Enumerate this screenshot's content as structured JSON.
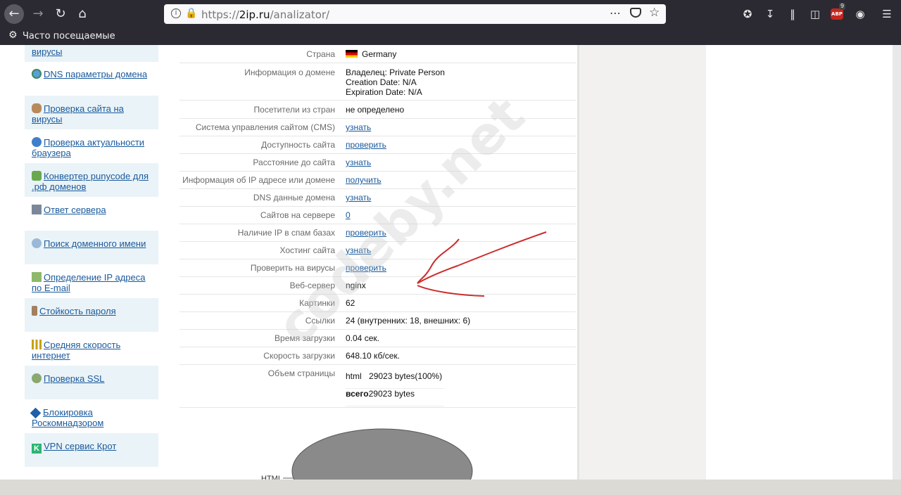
{
  "browser": {
    "url_scheme": "https://",
    "url_host": "2ip.ru",
    "url_path": "/analizator/",
    "bookmarks_label": "Часто посещаемые",
    "adblock_badge": "9",
    "adblock_label": "ABP"
  },
  "sidebar": {
    "items": [
      {
        "label": "вирусы"
      },
      {
        "label": "DNS параметры домена"
      },
      {
        "label": "Проверка сайта на вирусы"
      },
      {
        "label": "Проверка актуальности браузера"
      },
      {
        "label": "Конвертер punycode для .рф доменов"
      },
      {
        "label": "Ответ сервера"
      },
      {
        "label": "Поиск доменного имени"
      },
      {
        "label": "Определение IP адреса по E-mail"
      },
      {
        "label": "Стойкость пароля"
      },
      {
        "label": "Средняя скорость интернет"
      },
      {
        "label": "Проверка SSL"
      },
      {
        "label": "Блокировка Роскомнадзором"
      },
      {
        "label": "VPN сервис Крот"
      }
    ]
  },
  "results": {
    "country_label": "Страна",
    "country_value": "Germany",
    "domain_info_label": "Информация о домене",
    "domain_owner": "Владелец: Private Person",
    "domain_creation": "Creation Date: N/A",
    "domain_expiration": "Expiration Date: N/A",
    "rows": [
      {
        "label": "Посетители из стран",
        "value": "не определено",
        "link": false
      },
      {
        "label": "Система управления сайтом  (CMS)",
        "value": "узнать",
        "link": true
      },
      {
        "label": "Доступность сайта",
        "value": "проверить",
        "link": true
      },
      {
        "label": "Расстояние до сайта",
        "value": "узнать",
        "link": true
      },
      {
        "label": "Информация об IP адресе или домене",
        "value": "получить",
        "link": true
      },
      {
        "label": "DNS данные домена",
        "value": "узнать",
        "link": true
      },
      {
        "label": "Сайтов на сервере",
        "value": "0",
        "link": true
      },
      {
        "label": "Наличие IP в спам базах",
        "value": "проверить",
        "link": true
      },
      {
        "label": "Хостинг сайта",
        "value": "узнать",
        "link": true
      },
      {
        "label": "Проверить на вирусы",
        "value": "проверить",
        "link": true
      },
      {
        "label": "Веб-сервер",
        "value": "nginx",
        "link": false
      },
      {
        "label": "Картинки",
        "value": "62",
        "link": false
      },
      {
        "label": "Ссылки",
        "value": "24 (внутренних: 18, внешних: 6)",
        "link": false
      },
      {
        "label": "Время загрузки",
        "value": "0.04 сек.",
        "link": false
      },
      {
        "label": "Скорость загрузки",
        "value": "648.10 кб/сек.",
        "link": false
      }
    ],
    "page_size_label": "Объем страницы",
    "page_size_type": "html",
    "page_size_value": "29023 bytes(100%)",
    "total_label": "всего",
    "total_value": "29023 bytes"
  },
  "chart_data": {
    "type": "pie",
    "categories": [
      "HTML"
    ],
    "values": [
      100
    ],
    "colors": [
      "#8a8a8a"
    ]
  },
  "watermark": "codeby.net"
}
